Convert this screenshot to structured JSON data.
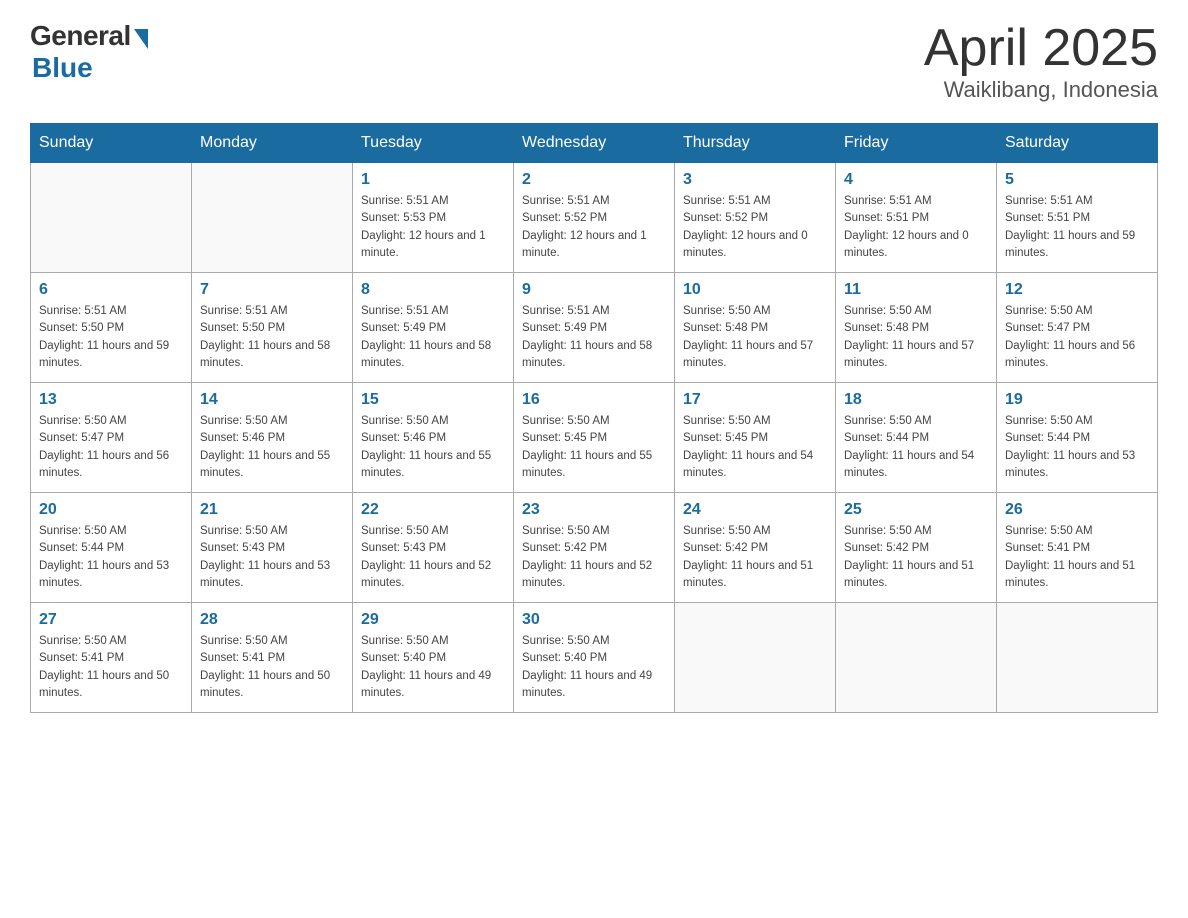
{
  "header": {
    "logo_general": "General",
    "logo_blue": "Blue",
    "title_month": "April 2025",
    "title_location": "Waiklibang, Indonesia"
  },
  "weekdays": [
    "Sunday",
    "Monday",
    "Tuesday",
    "Wednesday",
    "Thursday",
    "Friday",
    "Saturday"
  ],
  "weeks": [
    [
      {
        "day": "",
        "sunrise": "",
        "sunset": "",
        "daylight": ""
      },
      {
        "day": "",
        "sunrise": "",
        "sunset": "",
        "daylight": ""
      },
      {
        "day": "1",
        "sunrise": "Sunrise: 5:51 AM",
        "sunset": "Sunset: 5:53 PM",
        "daylight": "Daylight: 12 hours and 1 minute."
      },
      {
        "day": "2",
        "sunrise": "Sunrise: 5:51 AM",
        "sunset": "Sunset: 5:52 PM",
        "daylight": "Daylight: 12 hours and 1 minute."
      },
      {
        "day": "3",
        "sunrise": "Sunrise: 5:51 AM",
        "sunset": "Sunset: 5:52 PM",
        "daylight": "Daylight: 12 hours and 0 minutes."
      },
      {
        "day": "4",
        "sunrise": "Sunrise: 5:51 AM",
        "sunset": "Sunset: 5:51 PM",
        "daylight": "Daylight: 12 hours and 0 minutes."
      },
      {
        "day": "5",
        "sunrise": "Sunrise: 5:51 AM",
        "sunset": "Sunset: 5:51 PM",
        "daylight": "Daylight: 11 hours and 59 minutes."
      }
    ],
    [
      {
        "day": "6",
        "sunrise": "Sunrise: 5:51 AM",
        "sunset": "Sunset: 5:50 PM",
        "daylight": "Daylight: 11 hours and 59 minutes."
      },
      {
        "day": "7",
        "sunrise": "Sunrise: 5:51 AM",
        "sunset": "Sunset: 5:50 PM",
        "daylight": "Daylight: 11 hours and 58 minutes."
      },
      {
        "day": "8",
        "sunrise": "Sunrise: 5:51 AM",
        "sunset": "Sunset: 5:49 PM",
        "daylight": "Daylight: 11 hours and 58 minutes."
      },
      {
        "day": "9",
        "sunrise": "Sunrise: 5:51 AM",
        "sunset": "Sunset: 5:49 PM",
        "daylight": "Daylight: 11 hours and 58 minutes."
      },
      {
        "day": "10",
        "sunrise": "Sunrise: 5:50 AM",
        "sunset": "Sunset: 5:48 PM",
        "daylight": "Daylight: 11 hours and 57 minutes."
      },
      {
        "day": "11",
        "sunrise": "Sunrise: 5:50 AM",
        "sunset": "Sunset: 5:48 PM",
        "daylight": "Daylight: 11 hours and 57 minutes."
      },
      {
        "day": "12",
        "sunrise": "Sunrise: 5:50 AM",
        "sunset": "Sunset: 5:47 PM",
        "daylight": "Daylight: 11 hours and 56 minutes."
      }
    ],
    [
      {
        "day": "13",
        "sunrise": "Sunrise: 5:50 AM",
        "sunset": "Sunset: 5:47 PM",
        "daylight": "Daylight: 11 hours and 56 minutes."
      },
      {
        "day": "14",
        "sunrise": "Sunrise: 5:50 AM",
        "sunset": "Sunset: 5:46 PM",
        "daylight": "Daylight: 11 hours and 55 minutes."
      },
      {
        "day": "15",
        "sunrise": "Sunrise: 5:50 AM",
        "sunset": "Sunset: 5:46 PM",
        "daylight": "Daylight: 11 hours and 55 minutes."
      },
      {
        "day": "16",
        "sunrise": "Sunrise: 5:50 AM",
        "sunset": "Sunset: 5:45 PM",
        "daylight": "Daylight: 11 hours and 55 minutes."
      },
      {
        "day": "17",
        "sunrise": "Sunrise: 5:50 AM",
        "sunset": "Sunset: 5:45 PM",
        "daylight": "Daylight: 11 hours and 54 minutes."
      },
      {
        "day": "18",
        "sunrise": "Sunrise: 5:50 AM",
        "sunset": "Sunset: 5:44 PM",
        "daylight": "Daylight: 11 hours and 54 minutes."
      },
      {
        "day": "19",
        "sunrise": "Sunrise: 5:50 AM",
        "sunset": "Sunset: 5:44 PM",
        "daylight": "Daylight: 11 hours and 53 minutes."
      }
    ],
    [
      {
        "day": "20",
        "sunrise": "Sunrise: 5:50 AM",
        "sunset": "Sunset: 5:44 PM",
        "daylight": "Daylight: 11 hours and 53 minutes."
      },
      {
        "day": "21",
        "sunrise": "Sunrise: 5:50 AM",
        "sunset": "Sunset: 5:43 PM",
        "daylight": "Daylight: 11 hours and 53 minutes."
      },
      {
        "day": "22",
        "sunrise": "Sunrise: 5:50 AM",
        "sunset": "Sunset: 5:43 PM",
        "daylight": "Daylight: 11 hours and 52 minutes."
      },
      {
        "day": "23",
        "sunrise": "Sunrise: 5:50 AM",
        "sunset": "Sunset: 5:42 PM",
        "daylight": "Daylight: 11 hours and 52 minutes."
      },
      {
        "day": "24",
        "sunrise": "Sunrise: 5:50 AM",
        "sunset": "Sunset: 5:42 PM",
        "daylight": "Daylight: 11 hours and 51 minutes."
      },
      {
        "day": "25",
        "sunrise": "Sunrise: 5:50 AM",
        "sunset": "Sunset: 5:42 PM",
        "daylight": "Daylight: 11 hours and 51 minutes."
      },
      {
        "day": "26",
        "sunrise": "Sunrise: 5:50 AM",
        "sunset": "Sunset: 5:41 PM",
        "daylight": "Daylight: 11 hours and 51 minutes."
      }
    ],
    [
      {
        "day": "27",
        "sunrise": "Sunrise: 5:50 AM",
        "sunset": "Sunset: 5:41 PM",
        "daylight": "Daylight: 11 hours and 50 minutes."
      },
      {
        "day": "28",
        "sunrise": "Sunrise: 5:50 AM",
        "sunset": "Sunset: 5:41 PM",
        "daylight": "Daylight: 11 hours and 50 minutes."
      },
      {
        "day": "29",
        "sunrise": "Sunrise: 5:50 AM",
        "sunset": "Sunset: 5:40 PM",
        "daylight": "Daylight: 11 hours and 49 minutes."
      },
      {
        "day": "30",
        "sunrise": "Sunrise: 5:50 AM",
        "sunset": "Sunset: 5:40 PM",
        "daylight": "Daylight: 11 hours and 49 minutes."
      },
      {
        "day": "",
        "sunrise": "",
        "sunset": "",
        "daylight": ""
      },
      {
        "day": "",
        "sunrise": "",
        "sunset": "",
        "daylight": ""
      },
      {
        "day": "",
        "sunrise": "",
        "sunset": "",
        "daylight": ""
      }
    ]
  ]
}
